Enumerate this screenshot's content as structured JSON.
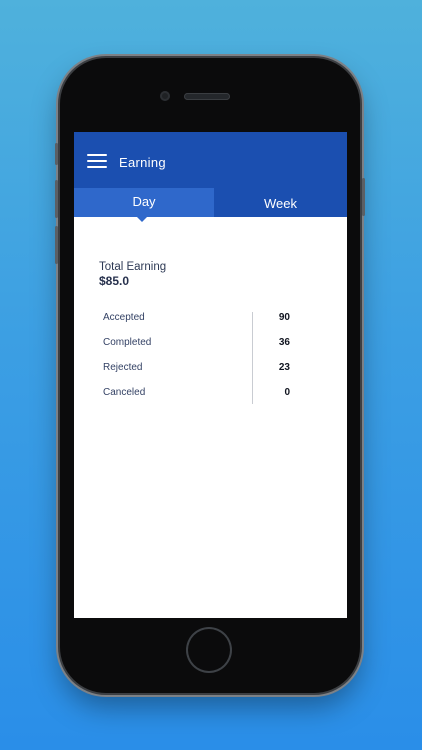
{
  "app_bar": {
    "title": "Earning"
  },
  "tabs": [
    {
      "label": "Day",
      "active": true
    },
    {
      "label": "Week",
      "active": false
    }
  ],
  "summary": {
    "total_label": "Total Earning",
    "total_value": "$85.0"
  },
  "stats": [
    {
      "label": "Accepted",
      "value": "90"
    },
    {
      "label": "Completed",
      "value": "36"
    },
    {
      "label": "Rejected",
      "value": "23"
    },
    {
      "label": "Canceled",
      "value": "0"
    }
  ],
  "colors": {
    "primary": "#1b4fb0",
    "active_tab": "#2f68cb",
    "background_top": "#4fb1dc",
    "background_bottom": "#2a8ee8"
  }
}
